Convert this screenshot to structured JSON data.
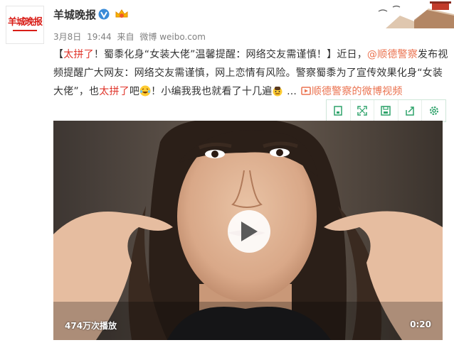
{
  "account": {
    "avatar_text": "羊城晚报",
    "name": "羊城晚报"
  },
  "meta": {
    "date": "3月8日",
    "time": "19:44",
    "from_label": "来自",
    "source": "微博 weibo.com"
  },
  "post": {
    "p1": "【",
    "p2": "太拼了",
    "p3": "！蜀黍化身“女装大佬”温馨提醒：网络交友需谨慎！】近日，",
    "mention": "@顺德警察",
    "p4": "发布视频提醒广大网友：网络交友需谨慎，网上恋情有风险。警察蜀黍为了宣传效果化身“女装大佬”，也",
    "p5": "太拼了",
    "p6": "吧",
    "p7": "！小编我我也就看了十几遍",
    "p8": " ... ",
    "video_link": "顺德警察的微博视频"
  },
  "video": {
    "play_count": "474万次播放",
    "duration": "0:20"
  },
  "colors": {
    "brand_red": "#d91e18",
    "link_orange": "#eb7350",
    "tool_green": "#2fa36b"
  },
  "icons": [
    "verified-icon",
    "vip-icon",
    "link-icon",
    "play-icon",
    "expand-icon",
    "save-icon",
    "share-icon",
    "settings-icon"
  ]
}
